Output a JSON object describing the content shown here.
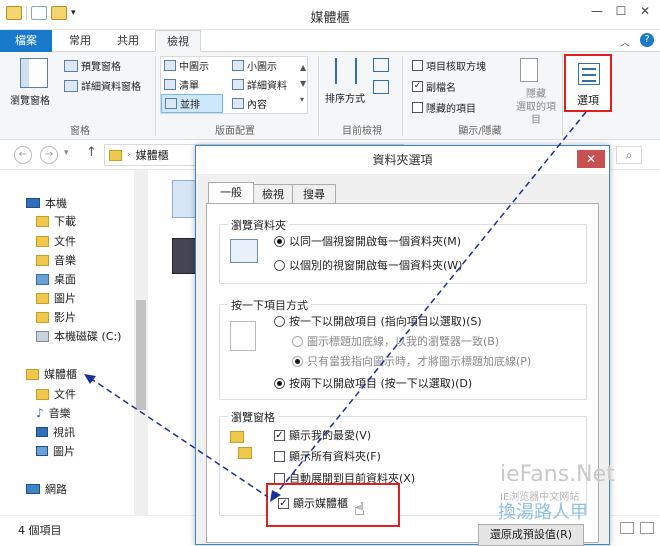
{
  "window": {
    "title": "媒體櫃"
  },
  "ribbon_tabs": [
    {
      "label": "檔案"
    },
    {
      "label": "常用"
    },
    {
      "label": "共用"
    },
    {
      "label": "檢視"
    }
  ],
  "ribbon": {
    "panes": {
      "nav_pane": "瀏覽窗格",
      "preview": "預覽窗格",
      "details": "詳細資料窗格",
      "label": "窗格"
    },
    "layout": {
      "medium": "中圖示",
      "small": "小圖示",
      "list": "清單",
      "details": "詳細資料",
      "tiles": "並排",
      "content": "內容",
      "label": "版面配置"
    },
    "current_view": {
      "sort": "排序方式",
      "label": "目前檢視"
    },
    "show_hide": {
      "item_check": "項目核取方塊",
      "extensions": "副檔名",
      "hidden_items": "隱藏的項目",
      "hide_selected": "隱藏",
      "hide_selected2": "選取的項目",
      "label": "顯示/隱藏"
    },
    "options": {
      "label": "選項"
    }
  },
  "address": {
    "location": "媒體櫃"
  },
  "sidebar": {
    "this_pc": "本機",
    "pc_items": [
      "下載",
      "文件",
      "音樂",
      "桌面",
      "圖片",
      "影片",
      "本機磁碟 (C:)"
    ],
    "libraries": "媒體櫃",
    "lib_items": [
      "文件",
      "音樂",
      "視訊",
      "圖片"
    ],
    "network": "網路"
  },
  "status": {
    "count": "4 個項目"
  },
  "dialog": {
    "title": "資料夾選項",
    "close": "✕",
    "tabs": [
      "一般",
      "檢視",
      "搜尋"
    ],
    "browse": {
      "legend": "瀏覽資料夾",
      "opt1": "以同一個視窗開啟每一個資料夾(M)",
      "opt2": "以個別的視窗開啟每一個資料夾(W)"
    },
    "click": {
      "legend": "按一下項目方式",
      "opt1": "按一下以開啟項目 (指向項目以選取)(S)",
      "sub1": "圖示標題加底線，以我的瀏覽器一致(B)",
      "sub2": "只有當我指向圖示時，才將圖示標題加底線(P)",
      "opt2": "按兩下以開啟項目 (按一下以選取)(D)"
    },
    "nav": {
      "legend": "瀏覽窗格",
      "opt1": "顯示我的最愛(V)",
      "opt2": "顯示所有資料夾(F)",
      "opt3": "自動展開到目前資料夾(X)",
      "opt4": "顯示媒體櫃"
    },
    "restore": "還原成預設值(R)"
  },
  "watermark": {
    "line1": "ieFans.Net",
    "line2": "IE浏览器中文网站",
    "line3": "換湯路人甲"
  },
  "colors": {
    "file_tab": "#1979ca",
    "highlight": "#e02020",
    "arrow": "#1b2f9e"
  }
}
